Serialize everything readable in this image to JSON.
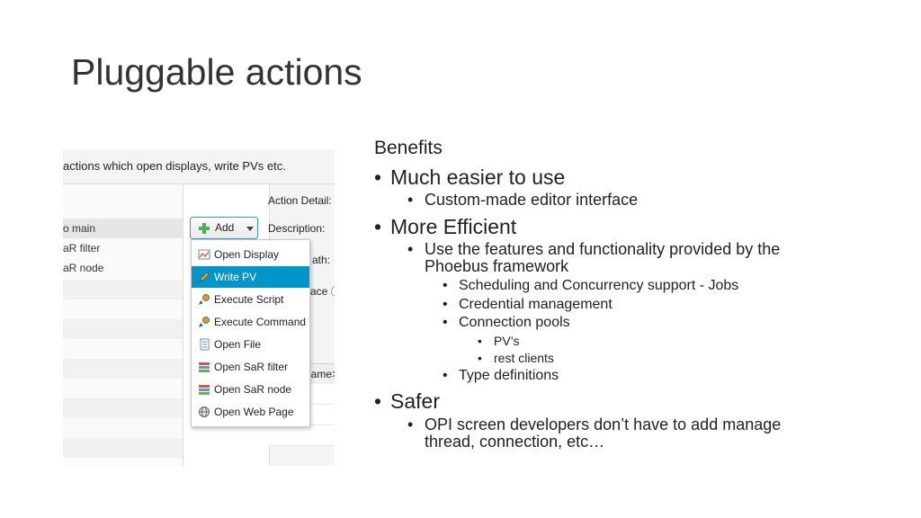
{
  "slide": {
    "title": "Pluggable actions"
  },
  "screenshot": {
    "header_text": "actions which open displays, write PVs etc.",
    "action_detail_label": "Action Detail:",
    "description_label": "Description:",
    "path_label": "ath:",
    "place_label": "ace",
    "table_header": "name>",
    "list_items": [
      "o main",
      "aR filter",
      "aR node"
    ],
    "add_button_label": "Add",
    "menu_items": [
      {
        "label": "Open Display",
        "icon": "open-display-icon"
      },
      {
        "label": "Write PV",
        "icon": "write-pv-icon"
      },
      {
        "label": "Execute Script",
        "icon": "execute-script-icon"
      },
      {
        "label": "Execute Command",
        "icon": "execute-command-icon"
      },
      {
        "label": "Open File",
        "icon": "open-file-icon"
      },
      {
        "label": "Open SaR filter",
        "icon": "sar-filter-icon"
      },
      {
        "label": "Open SaR node",
        "icon": "sar-node-icon"
      },
      {
        "label": "Open Web Page",
        "icon": "web-page-icon"
      }
    ],
    "active_menu_item": "Write PV",
    "colors": {
      "menu_highlight": "#0096c9",
      "add_button_border": "#3a93d8"
    }
  },
  "benefits": {
    "heading": "Benefits",
    "b1": "Much easier to use",
    "b1_1": "Custom-made editor interface",
    "b2": "More Efficient",
    "b2_1_line1": "Use the features and functionality provided by the",
    "b2_1_line2": "Phoebus framework",
    "b2_1_1": "Scheduling and Concurrency support - Jobs",
    "b2_1_2": "Credential management",
    "b2_1_3": "Connection pools",
    "b2_1_3_1": "PV’s",
    "b2_1_3_2": "rest clients",
    "b2_1_4": "Type definitions",
    "b3": "Safer",
    "b3_1_line1": "OPI screen developers don’t have to add manage",
    "b3_1_line2": "thread, connection, etc…"
  }
}
